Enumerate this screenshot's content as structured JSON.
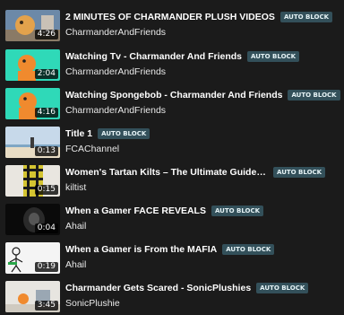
{
  "colors": {
    "background": "#1b1b1b",
    "badge_bg": "#33505a",
    "badge_text": "#e6f3f6"
  },
  "videos": [
    {
      "title": "2 MINUTES OF CHARMANDER PLUSH VIDEOS",
      "badge": "AUTO BLOCK",
      "channel": "CharmanderAndFriends",
      "duration": "4:26"
    },
    {
      "title": "Watching Tv - Charmander And Friends",
      "badge": "AUTO BLOCK",
      "channel": "CharmanderAndFriends",
      "duration": "2:04"
    },
    {
      "title": "Watching Spongebob - Charmander And Friends",
      "badge": "AUTO BLOCK",
      "channel": "CharmanderAndFriends",
      "duration": "4:16"
    },
    {
      "title": "Title 1",
      "badge": "AUTO BLOCK",
      "channel": "FCAChannel",
      "duration": "0:13"
    },
    {
      "title": "Women's Tartan Kilts – The Ultimate Guide to ...",
      "badge": "AUTO BLOCK",
      "channel": "kiltist",
      "duration": "0:15"
    },
    {
      "title": "When a Gamer FACE REVEALS",
      "badge": "AUTO BLOCK",
      "channel": "Ahail",
      "duration": "0:04"
    },
    {
      "title": "When a Gamer is From the MAFIA",
      "badge": "AUTO BLOCK",
      "channel": "Ahail",
      "duration": "0:19"
    },
    {
      "title": "Charmander Gets Scared - SonicPlushies",
      "badge": "AUTO BLOCK",
      "channel": "SonicPlushie",
      "duration": "3:45"
    }
  ]
}
